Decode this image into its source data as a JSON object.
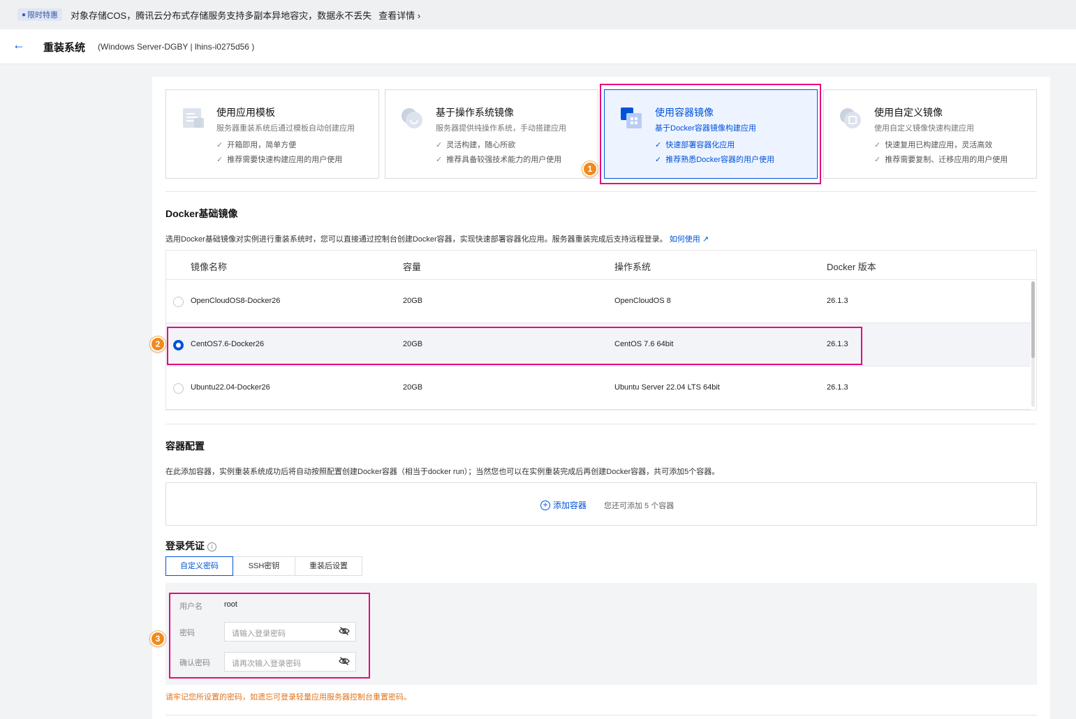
{
  "banner": {
    "badge": "限时特惠",
    "text": "对象存储COS，腾讯云分布式存储服务支持多副本异地容灾，数据永不丢失",
    "link": "查看详情"
  },
  "header": {
    "title": "重装系统",
    "subtitle": "(Windows Server-DGBY | lhins-i0275d56 )"
  },
  "image_types": [
    {
      "title": "使用应用模板",
      "desc": "服务器重装系统后通过模板自动创建应用",
      "features": [
        "开箱即用，简单方便",
        "推荐需要快速构建应用的用户使用"
      ],
      "selected": false,
      "icon": "template-icon"
    },
    {
      "title": "基于操作系统镜像",
      "desc": "服务器提供纯操作系统，手动搭建应用",
      "features": [
        "灵活构建，随心所欲",
        "推荐具备较强技术能力的用户使用"
      ],
      "selected": false,
      "icon": "os-image-icon"
    },
    {
      "title": "使用容器镜像",
      "desc": "基于Docker容器镜像构建应用",
      "features": [
        "快速部署容器化应用",
        "推荐熟悉Docker容器的用户使用"
      ],
      "selected": true,
      "icon": "container-icon"
    },
    {
      "title": "使用自定义镜像",
      "desc": "使用自定义镜像快速构建应用",
      "features": [
        "快速复用已构建应用，灵活高效",
        "推荐需要复制、迁移应用的用户使用"
      ],
      "selected": false,
      "icon": "custom-image-icon"
    }
  ],
  "markers": [
    "1",
    "2",
    "3"
  ],
  "docker": {
    "title": "Docker基础镜像",
    "desc": "选用Docker基础镜像对实例进行重装系统时，您可以直接通过控制台创建Docker容器，实现快速部署容器化应用。服务器重装完成后支持远程登录。",
    "link": "如何使用",
    "columns": [
      "镜像名称",
      "容量",
      "操作系统",
      "Docker 版本"
    ],
    "rows": [
      {
        "name": "OpenCloudOS8-Docker26",
        "size": "20GB",
        "os": "OpenCloudOS 8",
        "version": "26.1.3",
        "selected": false
      },
      {
        "name": "CentOS7.6-Docker26",
        "size": "20GB",
        "os": "CentOS 7.6 64bit",
        "version": "26.1.3",
        "selected": true
      },
      {
        "name": "Ubuntu22.04-Docker26",
        "size": "20GB",
        "os": "Ubuntu Server 22.04 LTS 64bit",
        "version": "26.1.3",
        "selected": false
      }
    ]
  },
  "container": {
    "title": "容器配置",
    "desc": "在此添加容器，实例重装系统成功后将自动按照配置创建Docker容器（相当于docker run）；当然您也可以在实例重装完成后再创建Docker容器，共可添加5个容器。",
    "add_label": "添加容器",
    "add_hint": "您还可添加 5 个容器"
  },
  "login": {
    "title": "登录凭证",
    "info_glyph": "i",
    "tabs": [
      "自定义密码",
      "SSH密钥",
      "重装后设置"
    ],
    "active_tab": 0,
    "username_label": "用户名",
    "username": "root",
    "password_label": "密码",
    "password_placeholder": "请输入登录密码",
    "confirm_label": "确认密码",
    "confirm_placeholder": "请再次输入登录密码",
    "warning": "请牢记您所设置的密码，如遗忘可登录轻量应用服务器控制台重置密码。"
  },
  "colors": {
    "primary": "#0052d9",
    "highlight": "#e5097f",
    "marker": "#f08a1c",
    "warning": "#e37318"
  }
}
